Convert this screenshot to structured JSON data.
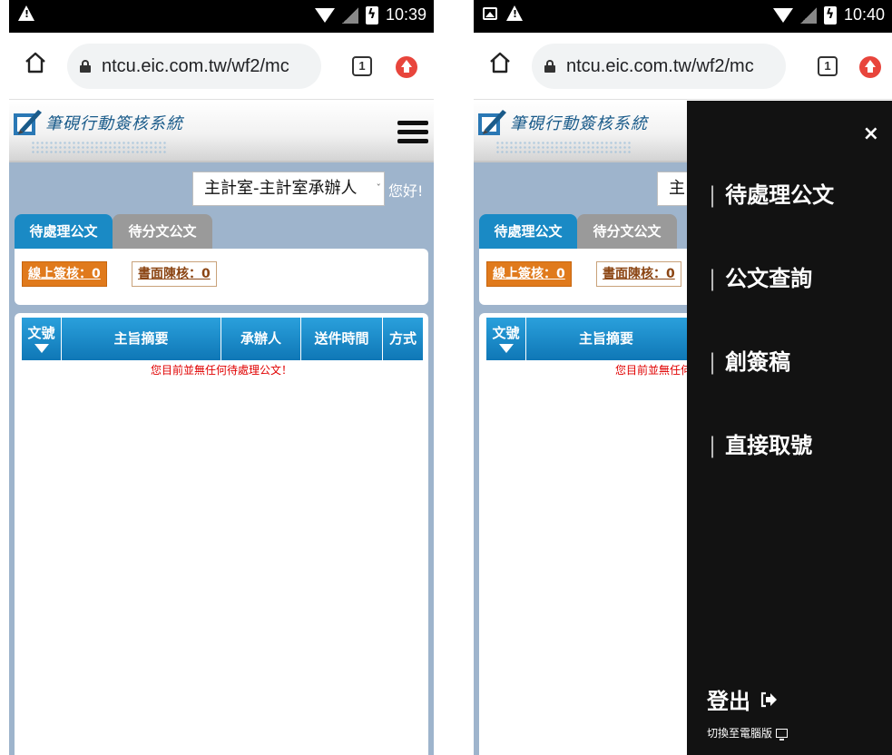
{
  "left": {
    "status": {
      "time": "10:39"
    },
    "browser": {
      "url": "ntcu.eic.com.tw/wf2/mc",
      "tab_count": "1"
    },
    "header": {
      "title": "筆硯行動簽核系統"
    },
    "user": {
      "role": "主計室-主計室承辦人",
      "greeting": "您好!"
    },
    "tabs": [
      {
        "label": "待處理公文"
      },
      {
        "label": "待分文公文"
      }
    ],
    "counters": {
      "online": "線上簽核：0",
      "paper": "書面陳核：0"
    },
    "table": {
      "headers": {
        "no": "文號",
        "subject": "主旨摘要",
        "handler": "承辦人",
        "time": "送件時間",
        "method": "方式"
      },
      "empty_message": "您目前並無任何待處理公文！"
    }
  },
  "right": {
    "status": {
      "time": "10:40"
    },
    "browser": {
      "url": "ntcu.eic.com.tw/wf2/mc",
      "tab_count": "1"
    },
    "header": {
      "title": "筆硯行動簽核系統"
    },
    "user": {
      "role_partial": "主"
    },
    "tabs": [
      {
        "label": "待處理公文"
      },
      {
        "label": "待分文公文"
      }
    ],
    "counters": {
      "online": "線上簽核：0",
      "paper": "書面陳核：0"
    },
    "table": {
      "headers": {
        "no": "文號",
        "subject": "主旨摘要"
      },
      "empty_message": "您目前並無任何待處理公文！"
    },
    "drawer": {
      "close": "×",
      "items": [
        {
          "label": "待處理公文"
        },
        {
          "label": "公文查詢"
        },
        {
          "label": "創簽稿"
        },
        {
          "label": "直接取號"
        }
      ],
      "logout": "登出",
      "switch_desktop": "切換至電腦版"
    }
  },
  "colors": {
    "tab_active": "#1a8ac5",
    "tab_inactive": "#9a9a9a",
    "page_bg": "#9eb4cc",
    "online_btn": "#e07a1c",
    "drawer_bg": "#121212",
    "empty_text": "#e00000"
  }
}
